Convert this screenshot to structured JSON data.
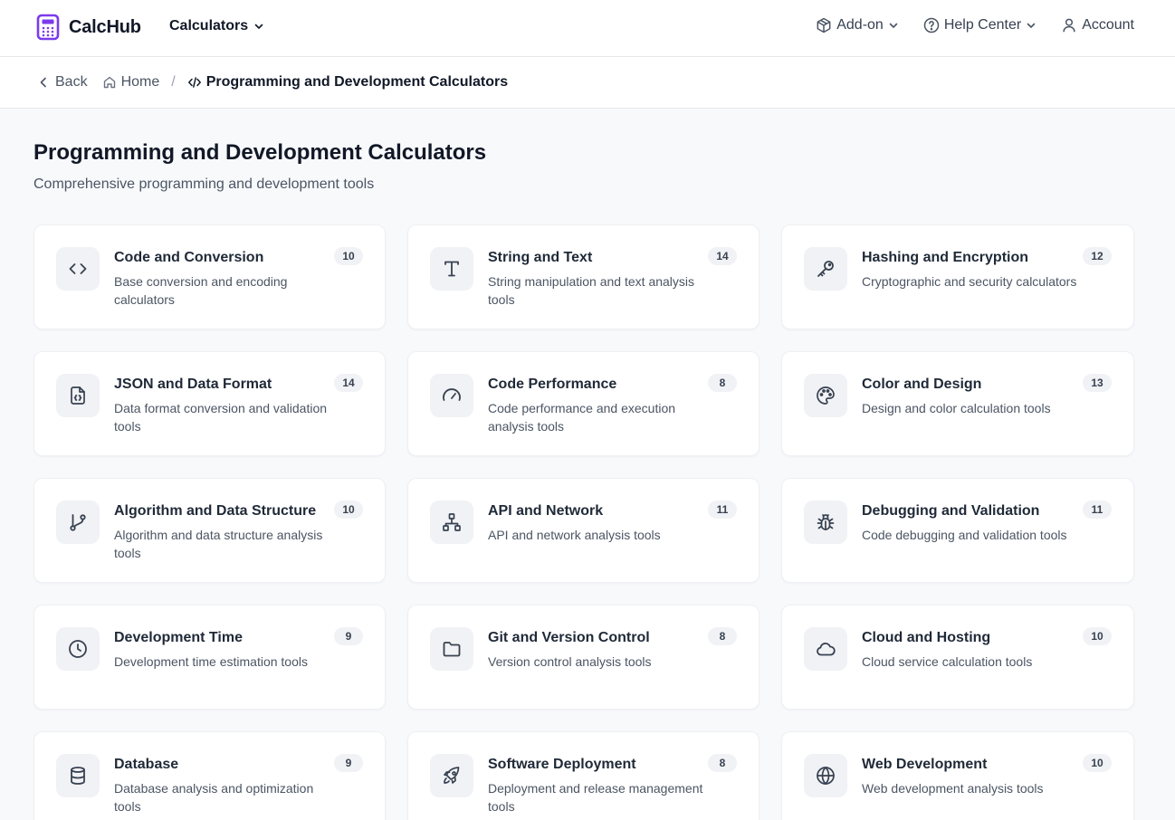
{
  "header": {
    "brand": "CalcHub",
    "calculators_label": "Calculators",
    "addon_label": "Add-on",
    "help_label": "Help Center",
    "account_label": "Account",
    "brand_color": "#7c3aed"
  },
  "breadcrumb": {
    "back_label": "Back",
    "home_label": "Home",
    "separator": "/",
    "current_label": "Programming and Development Calculators"
  },
  "page": {
    "title": "Programming and Development Calculators",
    "subtitle": "Comprehensive programming and development tools"
  },
  "categories": [
    {
      "title": "Code and Conversion",
      "desc": "Base conversion and encoding calculators",
      "count": "10",
      "icon": "code-icon"
    },
    {
      "title": "String and Text",
      "desc": "String manipulation and text analysis tools",
      "count": "14",
      "icon": "type-icon"
    },
    {
      "title": "Hashing and Encryption",
      "desc": "Cryptographic and security calculators",
      "count": "12",
      "icon": "key-icon"
    },
    {
      "title": "JSON and Data Format",
      "desc": "Data format conversion and validation tools",
      "count": "14",
      "icon": "file-json-icon"
    },
    {
      "title": "Code Performance",
      "desc": "Code performance and execution analysis tools",
      "count": "8",
      "icon": "gauge-icon"
    },
    {
      "title": "Color and Design",
      "desc": "Design and color calculation tools",
      "count": "13",
      "icon": "palette-icon"
    },
    {
      "title": "Algorithm and Data Structure",
      "desc": "Algorithm and data structure analysis tools",
      "count": "10",
      "icon": "git-branch-icon"
    },
    {
      "title": "API and Network",
      "desc": "API and network analysis tools",
      "count": "11",
      "icon": "network-icon"
    },
    {
      "title": "Debugging and Validation",
      "desc": "Code debugging and validation tools",
      "count": "11",
      "icon": "bug-icon"
    },
    {
      "title": "Development Time",
      "desc": "Development time estimation tools",
      "count": "9",
      "icon": "clock-icon"
    },
    {
      "title": "Git and Version Control",
      "desc": "Version control analysis tools",
      "count": "8",
      "icon": "folder-icon"
    },
    {
      "title": "Cloud and Hosting",
      "desc": "Cloud service calculation tools",
      "count": "10",
      "icon": "cloud-icon"
    },
    {
      "title": "Database",
      "desc": "Database analysis and optimization tools",
      "count": "9",
      "icon": "database-icon"
    },
    {
      "title": "Software Deployment",
      "desc": "Deployment and release management tools",
      "count": "8",
      "icon": "rocket-icon"
    },
    {
      "title": "Web Development",
      "desc": "Web development analysis tools",
      "count": "10",
      "icon": "globe-icon"
    }
  ]
}
